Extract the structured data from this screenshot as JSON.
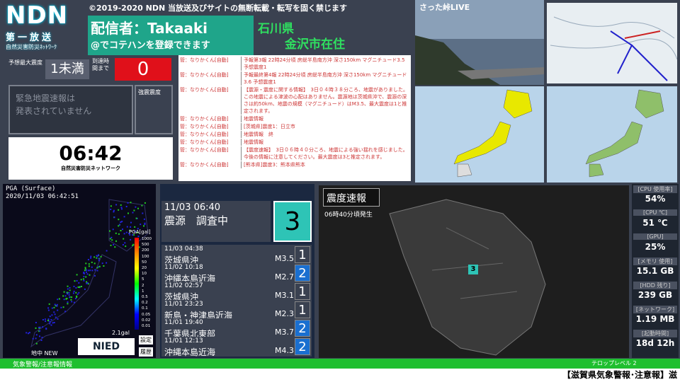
{
  "logo": {
    "big": "NDN",
    "line1": "第一放送",
    "line2": "自然災害防災ﾈｯﾄﾜｰｸ"
  },
  "copyright": "©2019-2020 NDN 当放送及びサイトの無断転載・転写を固く禁じます",
  "broadcaster": {
    "name": "配信者：Takaaki",
    "sub": "@でコテハンを登録できます"
  },
  "location": {
    "pref": "石川県",
    "city": "金沢市在住"
  },
  "intensity": {
    "label": "予想最大震度",
    "value": "1未満"
  },
  "until": {
    "label": "到達時間まで",
    "value": "0"
  },
  "eew": {
    "text1": "緊急地震速報は",
    "text2": "発表されていません",
    "strong_label": "強震震度"
  },
  "clock": {
    "time": "06:42",
    "network": "自然災害防災ネットワーク"
  },
  "messages": [
    {
      "a": "管：なりかくん[自動]",
      "b": "予報第3報 22時24分頃 房総半島南方沖 深さ150km マグニチュード3.5 予想震度1"
    },
    {
      "a": "管：なりかくん[自動]",
      "b": "予報最終第4報 22時24分頃 房総半島南方沖 深さ150km マグニチュード3.6 予想震度1"
    },
    {
      "a": "管：なりかくん[自動]",
      "b": "【震源・震度に関する情報】　3日０４時３８分ころ、地震がありました。この地震による津波の心配はありません。震源地は茨城県沖で、震源の深さは約50km、地震の規模（マグニチュード）はM3.5、最大震度は1と推定されます。"
    },
    {
      "a": "管：なりかくん[自動]",
      "b": "地震情報"
    },
    {
      "a": "管：なりかくん[自動]",
      "b": "[茨城県]震度1：日立市"
    },
    {
      "a": "管：なりかくん[自動]",
      "b": "地震情報　終"
    },
    {
      "a": "管：なりかくん[自動]",
      "b": "地震情報"
    },
    {
      "a": "管：なりかくん[自動]",
      "b": "【震度速報】　3日０６時４０分ころ、地震による強い揺れを感じました。今後の情報に注意してください。最大震度は3と推定されます。"
    },
    {
      "a": "管：なりかくん[自動]",
      "b": "[熊本県]震度3：熊本県熊本"
    }
  ],
  "live": {
    "label": "さった峠LIVE"
  },
  "pga": {
    "title": "PGA (Surface)",
    "datetime": "2020/11/03 06:42:51",
    "unit": "PGA[gal]",
    "scale": [
      "1000",
      "500",
      "200",
      "100",
      "50",
      "20",
      "10",
      "5",
      "2",
      "1",
      "0.5",
      "0.2",
      "0.1",
      "0.05",
      "0.02",
      "0.01"
    ],
    "min": "2.1gal",
    "footer": "地中 NEW",
    "btn1": "設定",
    "btn2": "履歴",
    "logo": "NIED"
  },
  "latest": {
    "datetime": "11/03 06:40",
    "place": "震源　調査中",
    "intensity": "3"
  },
  "quakes": [
    {
      "datetime": "11/03 04:38",
      "place": "茨城県沖",
      "mag": "M3.5",
      "int": "1"
    },
    {
      "datetime": "11/02 10:18",
      "place": "沖縄本島近海",
      "mag": "M2.7",
      "int": "2"
    },
    {
      "datetime": "11/02 02:57",
      "place": "茨城県沖",
      "mag": "M3.1",
      "int": "1"
    },
    {
      "datetime": "11/01 23:23",
      "place": "新島・神津島近海",
      "mag": "M2.3",
      "int": "1"
    },
    {
      "datetime": "11/01 19:40",
      "place": "千葉県北東部",
      "mag": "M3.7",
      "int": "2"
    },
    {
      "datetime": "11/01 12:13",
      "place": "沖縄本島近海",
      "mag": "M4.3",
      "int": "2"
    }
  ],
  "main": {
    "title": "震度速報",
    "time": "06時40分頃発生",
    "marker": "3"
  },
  "sys": [
    {
      "label": "[CPU 使用率]",
      "value": "54%"
    },
    {
      "label": "[CPU ℃]",
      "value": "51 ℃"
    },
    {
      "label": "[GPU]",
      "value": "25%"
    },
    {
      "label": "[メモリ 使用]",
      "value": "15.1 GB"
    },
    {
      "label": "[HDD 残り]",
      "value": "239 GB"
    },
    {
      "label": "[ネットワーク]",
      "value": "1.19 MB"
    },
    {
      "label": "[起動時間]",
      "value": "18d 12h"
    }
  ],
  "bottom": {
    "left": "気象警報/注意報情報",
    "right": "テロップレベル 2"
  },
  "ticker": "【滋賀県気象警報･注意報】滋",
  "colors": {
    "accent": "#1fa58a",
    "alert": "#e0101a",
    "green": "#1fbf2f",
    "int1": "#3a4150",
    "int2": "#1a6fd0",
    "int3": "#2ec4b6"
  }
}
